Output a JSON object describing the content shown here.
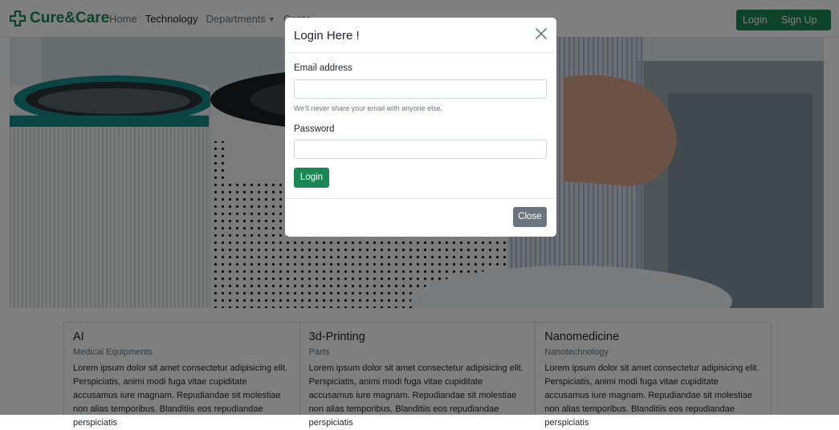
{
  "brand": {
    "name": "Cure&Care",
    "icon": "medical-cross-icon"
  },
  "nav": {
    "links": [
      {
        "label": "Home"
      },
      {
        "label": "Technology"
      },
      {
        "label": "Departments"
      },
      {
        "label": "Conta"
      }
    ],
    "login_label": "Login",
    "signup_label": "Sign Up"
  },
  "cards": [
    {
      "title": "AI",
      "subtitle": "Medical Equipments",
      "text": "Lorem ipsum dolor sit amet consectetur adipisicing elit. Perspiciatis, animi modi fuga vitae cupiditate accusamus iure magnam. Repudiandae sit molestiae non alias temporibus. Blanditiis eos repudiandae perspiciatis"
    },
    {
      "title": "3d-Printing",
      "subtitle": "Parts",
      "text": "Lorem ipsum dolor sit amet consectetur adipisicing elit. Perspiciatis, animi modi fuga vitae cupiditate accusamus iure magnam. Repudiandae sit molestiae non alias temporibus. Blanditiis eos repudiandae perspiciatis"
    },
    {
      "title": "Nanomedicine",
      "subtitle": "Nanotechnology",
      "text": "Lorem ipsum dolor sit amet consectetur adipisicing elit. Perspiciatis, animi modi fuga vitae cupiditate accusamus iure magnam. Repudiandae sit molestiae non alias temporibus. Blanditiis eos repudiandae perspiciatis"
    }
  ],
  "modal": {
    "title": "Login Here !",
    "email_label": "Email address",
    "email_value": "",
    "email_help": "We'll never share your email with anyone else.",
    "password_label": "Password",
    "password_value": "",
    "login_label": "Login",
    "close_label": "Close"
  },
  "colors": {
    "brand_green": "#198754",
    "secondary_gray": "#6c757d",
    "backdrop": "rgba(0,0,0,0.5)"
  }
}
